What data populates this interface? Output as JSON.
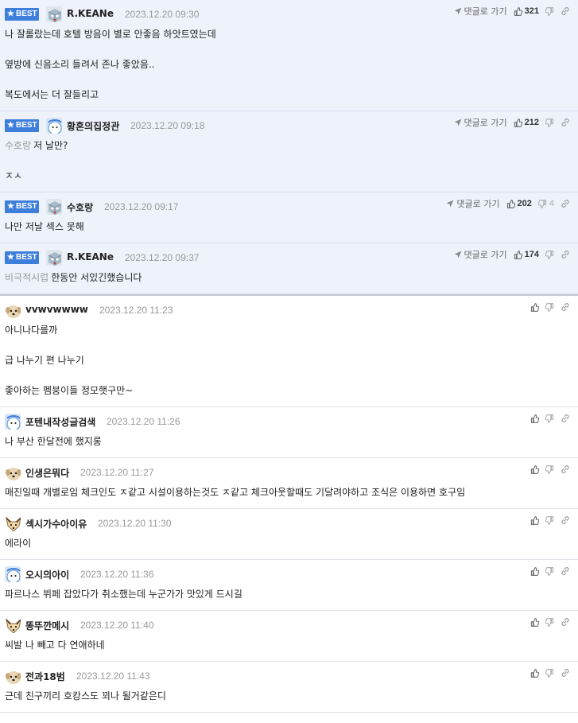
{
  "labels": {
    "best": "BEST",
    "goto": "댓글로 가기"
  },
  "colors": {
    "best_bg": "#eef3fb",
    "badge": "#3f7fdc",
    "date": "#999999"
  },
  "best_comments": [
    {
      "nick": "R.KEANe",
      "date": "2023.12.20 09:30",
      "likes": "321",
      "dislikes": "",
      "mention": "",
      "avatar": "cube-avatar",
      "lines": [
        "나 잘롤랐는데 호텔 방음이 별로 안좋음 하앗트였는데",
        "옆방에 신음소리 들려서 존나 좋았음..",
        "복도에서는 더 잘들리고"
      ]
    },
    {
      "nick": "황혼의집정관",
      "date": "2023.12.20 09:18",
      "likes": "212",
      "dislikes": "",
      "mention": "수호랑",
      "avatar": "snowman-avatar",
      "lines": [
        "저 날만?",
        "ㅈㅅ"
      ]
    },
    {
      "nick": "수호랑",
      "date": "2023.12.20 09:17",
      "likes": "202",
      "dislikes": "4",
      "mention": "",
      "avatar": "cube-avatar",
      "lines": [
        "나만 저날 섹스 못해"
      ]
    },
    {
      "nick": "R.KEANe",
      "date": "2023.12.20 09:37",
      "likes": "174",
      "dislikes": "",
      "mention": "비극적시럽",
      "avatar": "cube-avatar",
      "lines": [
        "한동안 서있긴했습니다"
      ]
    }
  ],
  "comments": [
    {
      "nick": "vvwvwwww",
      "date": "2023.12.20 11:23",
      "avatar": "puppy-avatar",
      "lines": [
        "아니나다를까",
        "급 나누기 편 나누기",
        "좋아하는 펨붕이들 정모햇구만~"
      ]
    },
    {
      "nick": "포텐내작성글검색",
      "date": "2023.12.20 11:26",
      "avatar": "snowman-avatar",
      "lines": [
        "나 부산 한달전에 했지롱"
      ]
    },
    {
      "nick": "인생은뭐다",
      "date": "2023.12.20 11:27",
      "avatar": "puppy-avatar",
      "lines": [
        "매진일때 개별로임 체크인도 ㅈ같고 시설이용하는것도 ㅈ같고 체크아웃할때도 기달려야하고 조식은 이용하면 호구임"
      ]
    },
    {
      "nick": "섹시가수아이유",
      "date": "2023.12.20 11:30",
      "avatar": "fox-avatar",
      "lines": [
        "에라이"
      ]
    },
    {
      "nick": "오시의아이",
      "date": "2023.12.20 11:36",
      "avatar": "snowman-avatar",
      "lines": [
        "파르나스 뷔페 잡았다가 취소했는데 누군가가 맛있게 드시길"
      ]
    },
    {
      "nick": "똥뚜깐메시",
      "date": "2023.12.20 11:40",
      "avatar": "fox-avatar",
      "lines": [
        "씨발 나 빼고 다 연애하네"
      ]
    },
    {
      "nick": "전과18범",
      "date": "2023.12.20 11:43",
      "avatar": "puppy-avatar",
      "lines": [
        "근데 친구끼리 호캉스도 꾀나 될거같은디"
      ]
    }
  ]
}
